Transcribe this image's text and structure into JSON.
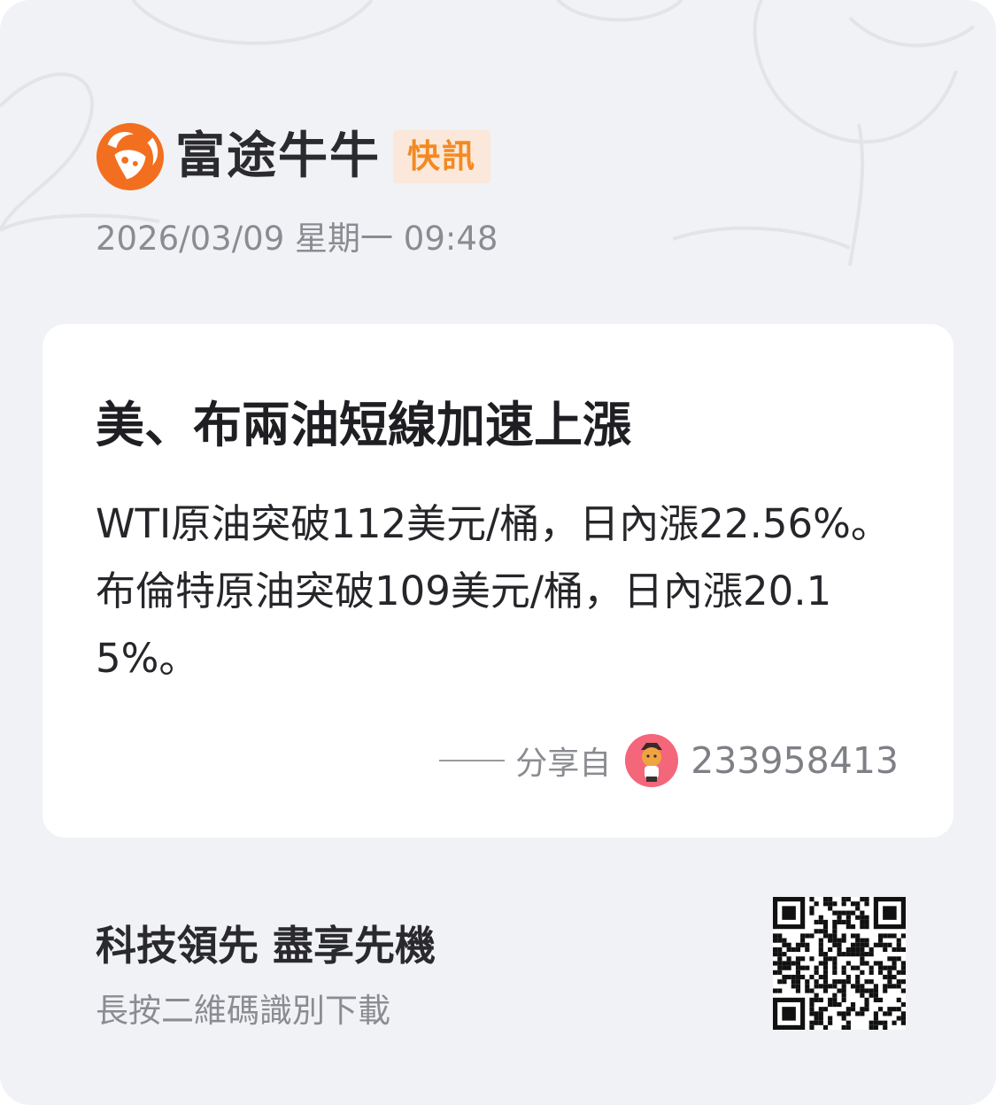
{
  "brand": {
    "name": "富途牛牛",
    "badge": "快訊",
    "logo_icon": "futu-bull-logo-icon",
    "accent_color": "#f36f20"
  },
  "date": "2026/03/09 星期一 09:48",
  "card": {
    "headline": "美、布兩油短線加速上漲",
    "body": "WTI原油突破112美元/桶，日內漲22.56%。布倫特原油突破109美元/桶，日內漲20.15%。",
    "share": {
      "label": "分享自",
      "user_id": "233958413",
      "avatar_icon": "user-avatar-icon"
    }
  },
  "footer": {
    "slogan": "科技領先 盡享先機",
    "subslogan": "長按二維碼識別下載",
    "qr_icon": "qr-code-icon"
  }
}
